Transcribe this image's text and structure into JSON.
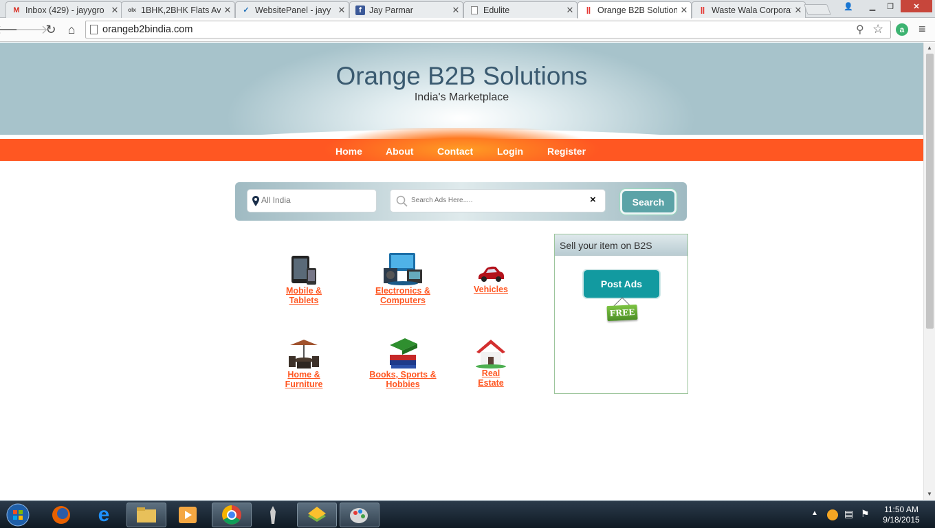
{
  "browser": {
    "tabs": [
      {
        "title": "Inbox (429) - jayygro",
        "icon": "gmail-icon",
        "active": false
      },
      {
        "title": "1BHK,2BHK Flats Ava",
        "icon": "olx-icon",
        "active": false
      },
      {
        "title": "WebsitePanel - jayy",
        "icon": "websitepanel-icon",
        "active": false
      },
      {
        "title": "Jay Parmar",
        "icon": "facebook-icon",
        "active": false
      },
      {
        "title": "Edulite",
        "icon": "page-icon",
        "active": false
      },
      {
        "title": "Orange B2B Solution",
        "icon": "orange-icon",
        "active": true
      },
      {
        "title": "Waste Wala Corporat",
        "icon": "orange-icon",
        "active": false
      }
    ],
    "url": "orangeb2bindia.com"
  },
  "site": {
    "title": "Orange B2B Solutions",
    "subtitle": "India's Marketplace",
    "nav": [
      "Home",
      "About",
      "Contact",
      "Login",
      "Register"
    ],
    "search": {
      "location_placeholder": "All India",
      "query_placeholder": "Search Ads Here.....",
      "clear_label": "×",
      "button_label": "Search"
    },
    "categories": [
      {
        "line1": "Mobile &",
        "line2": "Tablets",
        "icon": "tablet-icon"
      },
      {
        "line1": "Electronics &",
        "line2": "Computers",
        "icon": "electronics-icon"
      },
      {
        "line1": "Vehicles",
        "line2": "",
        "icon": "car-icon"
      },
      {
        "line1": "Home &",
        "line2": "Furniture",
        "icon": "furniture-icon"
      },
      {
        "line1": "Books, Sports &",
        "line2": "Hobbies",
        "icon": "books-icon"
      },
      {
        "line1": "Real",
        "line2": "Estate",
        "icon": "house-icon"
      }
    ],
    "sell": {
      "heading": "Sell your item on B2S",
      "button": "Post Ads",
      "tag": "FREE"
    }
  },
  "taskbar": {
    "time": "11:50 AM",
    "date": "9/18/2015"
  },
  "colors": {
    "accent": "#ff5722",
    "header": "#a7c3cb",
    "button_teal": "#129aa0",
    "link": "#ff5722"
  }
}
